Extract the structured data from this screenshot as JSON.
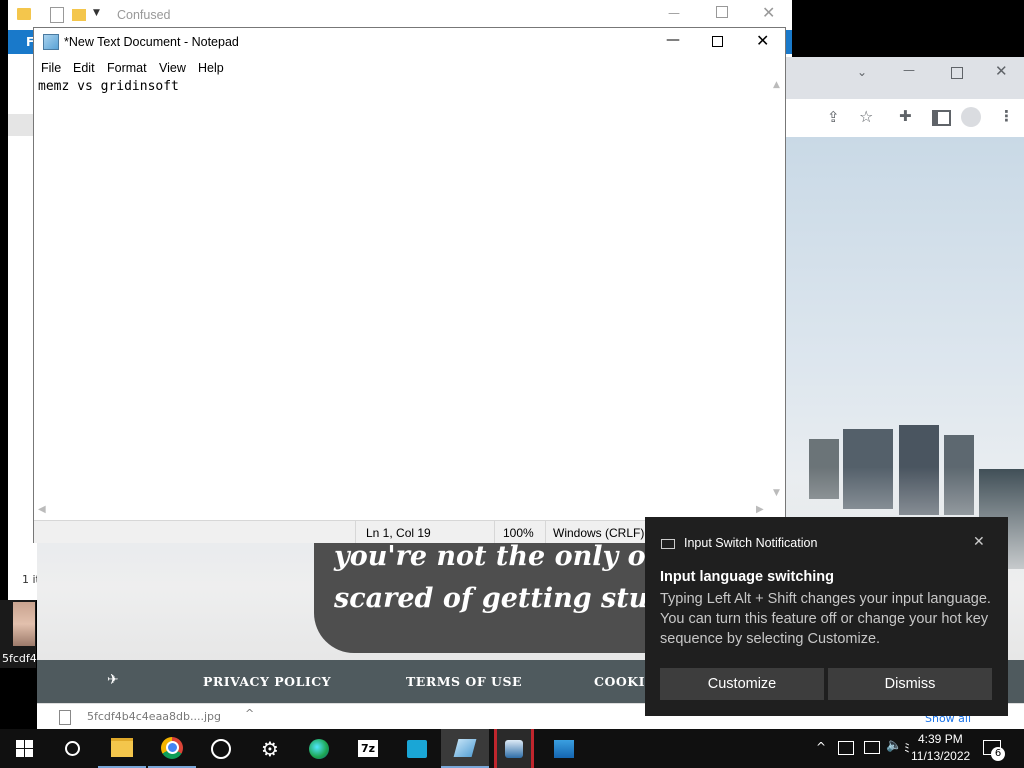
{
  "explorer": {
    "title": "Confused",
    "status_text": "1 it",
    "file_label": "F"
  },
  "desktop_icon": {
    "label": "5fcdf4"
  },
  "chrome": {
    "page": {
      "quote_line1": "you're not the only one w",
      "quote_line2": "scared of getting stung. '",
      "footer_links": [
        "PRIVACY POLICY",
        "TERMS OF USE",
        "COOKI"
      ]
    },
    "download": {
      "filename": "5fcdf4b4c4eaa8db....jpg",
      "show_all": "Show all"
    }
  },
  "notepad": {
    "title": "*New Text Document - Notepad",
    "menu": [
      "File",
      "Edit",
      "Format",
      "View",
      "Help"
    ],
    "content": "memz vs gridinsoft",
    "status": {
      "position": "Ln 1, Col 19",
      "zoom": "100%",
      "line_ending": "Windows (CRLF)"
    }
  },
  "notification": {
    "app": "Input Switch Notification",
    "heading": "Input language switching",
    "body": "Typing Left Alt + Shift changes your input language. You can turn this feature off or change your hot key sequence by selecting Customize.",
    "buttons": {
      "customize": "Customize",
      "dismiss": "Dismiss"
    }
  },
  "taskbar": {
    "time": "4:39 PM",
    "date": "11/13/2022",
    "notification_count": "6",
    "apps": [
      "start-icon",
      "search-icon",
      "file-explorer-icon",
      "chrome-icon",
      "speedometer-icon",
      "settings-icon",
      "edge-icon",
      "7zip-icon",
      "remote-icon",
      "notepad-icon",
      "gridinsoft-icon",
      "photos-icon"
    ]
  },
  "colors": {
    "taskbar_bg": "#101010",
    "notif_bg": "#1f1f1f",
    "notif_text": "#c7c7c7",
    "accent": "#0078d7"
  }
}
